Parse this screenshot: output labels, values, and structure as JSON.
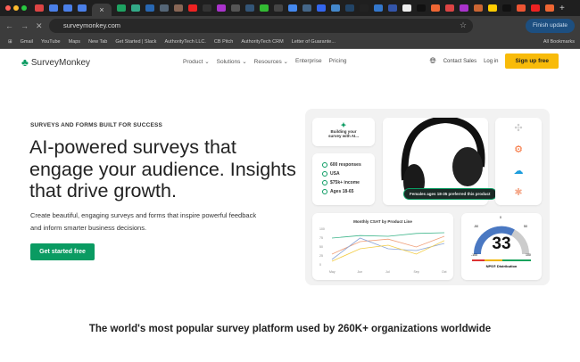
{
  "browser": {
    "active_tab_close": "×",
    "url": "surveymonkey.com",
    "finish_update": "Finish update",
    "bookmarks": [
      "Gmail",
      "YouTube",
      "Maps",
      "New Tab",
      "Get Started | Slack",
      "AuthorityTech LLC.",
      "CB Pitch",
      "AuthorityTech CRM",
      "Letter of Guarante..."
    ],
    "all_bookmarks": "All Bookmarks"
  },
  "nav": {
    "logo": "SurveyMonkey",
    "menu": [
      "Product ⌄",
      "Solutions ⌄",
      "Resources ⌄",
      "Enterprise",
      "Pricing"
    ],
    "contact": "Contact Sales",
    "login": "Log in",
    "signup": "Sign up free"
  },
  "hero": {
    "eyebrow": "SURVEYS AND FORMS BUILT FOR SUCCESS",
    "title": "AI-powered surveys that engage your audience. Insights that drive growth.",
    "subtitle": "Create beautiful, engaging surveys and forms that inspire powerful feedback and inform smarter business decisions.",
    "cta": "Get started free"
  },
  "dashboard": {
    "ai_card": "Building your survey with AI...",
    "stats": [
      "600 responses",
      "USA",
      "$75k+ income",
      "Ages 18-65"
    ],
    "product_pill": "Females ages 18-35 preferred this product",
    "csat": {
      "title": "Monthly CSAT by Product Line",
      "yticks": [
        "100",
        "75",
        "50",
        "25",
        "0"
      ],
      "months": [
        "May",
        "Jun",
        "Jul",
        "Sep",
        "Oct"
      ],
      "series": [
        {
          "color": "#3fb68b",
          "values": [
            75,
            82,
            80,
            88,
            90
          ]
        },
        {
          "color": "#f0a07a",
          "values": [
            30,
            65,
            72,
            50,
            80
          ]
        },
        {
          "color": "#8aa4d6",
          "values": [
            15,
            75,
            45,
            40,
            60
          ]
        },
        {
          "color": "#f2cc45",
          "values": [
            10,
            45,
            55,
            30,
            68
          ]
        }
      ]
    },
    "nps": {
      "value": "33",
      "ticks": [
        "0",
        "-50",
        "50",
        "-100",
        "100"
      ],
      "label": "NPS® Distribution"
    }
  },
  "bottom_heading": "The world's most popular survey platform used by 260K+ organizations worldwide"
}
